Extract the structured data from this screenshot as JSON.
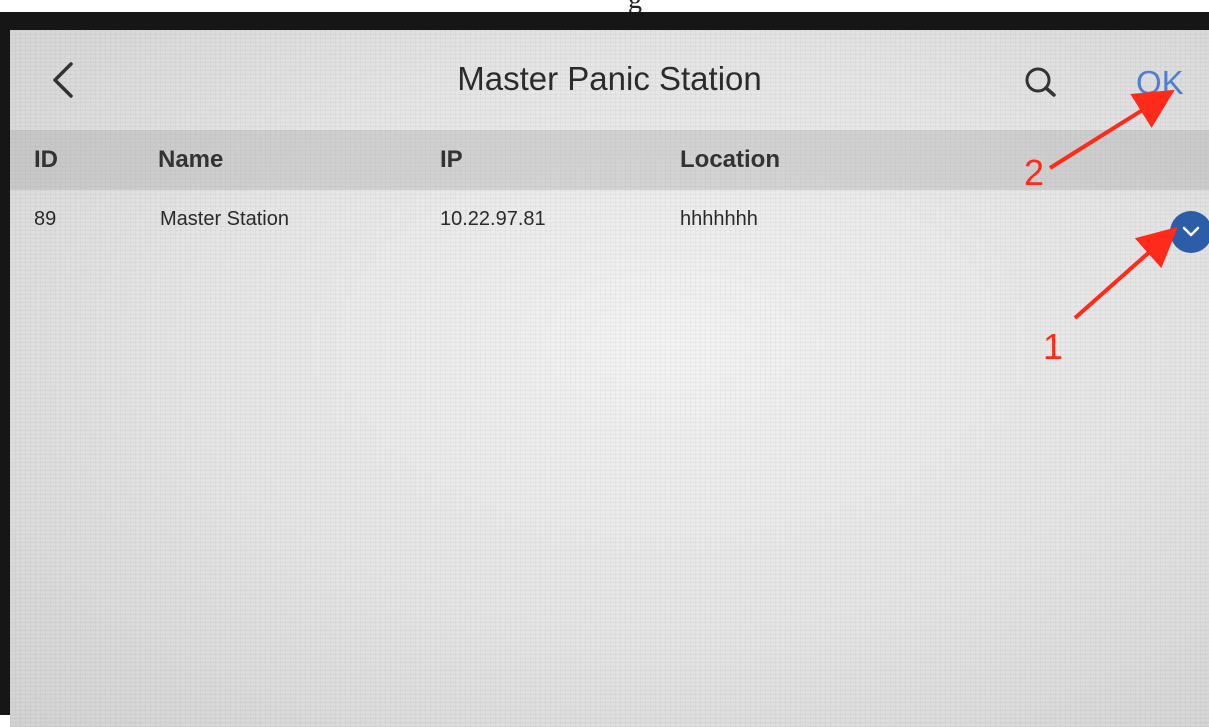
{
  "header": {
    "title": "Master Panic Station",
    "back_icon": "chevron-left-icon",
    "search_icon": "search-icon",
    "ok_label": "OK"
  },
  "table": {
    "columns": [
      "ID",
      "Name",
      "IP",
      "Location"
    ],
    "rows": [
      {
        "id": "89",
        "name": "Master Station",
        "ip": "10.22.97.81",
        "location": "hhhhhhh",
        "selected": true
      }
    ]
  },
  "annotations": {
    "label_1": "1",
    "label_2": "2",
    "color": "#ff2a1a"
  },
  "colors": {
    "accent": "#4f7fd0",
    "checkbox": "#2c5da8"
  }
}
